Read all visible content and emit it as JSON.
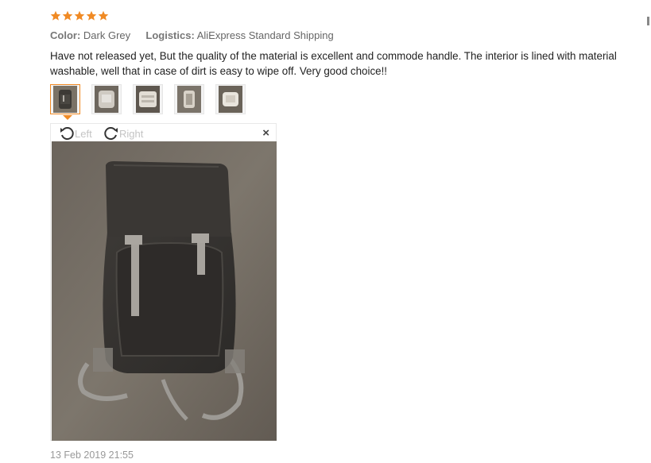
{
  "rating": {
    "stars": 5,
    "max": 5,
    "color": "#f08a24"
  },
  "meta": {
    "color_label": "Color:",
    "color_value": "Dark Grey",
    "logistics_label": "Logistics:",
    "logistics_value": "AliExpress Standard Shipping"
  },
  "review": {
    "text": "Have not released yet, But the quality of the material is excellent and commode handle. The interior is lined with material washable, well that in case of dirt is easy to wipe off. Very good choice!!"
  },
  "thumbnails": {
    "count": 5,
    "selected_index": 0
  },
  "viewer": {
    "rotate_left": "Left",
    "rotate_right": "Right",
    "close": "×"
  },
  "date": "13 Feb 2019 21:55",
  "colors": {
    "accent": "#f08a24",
    "muted": "#999999"
  }
}
